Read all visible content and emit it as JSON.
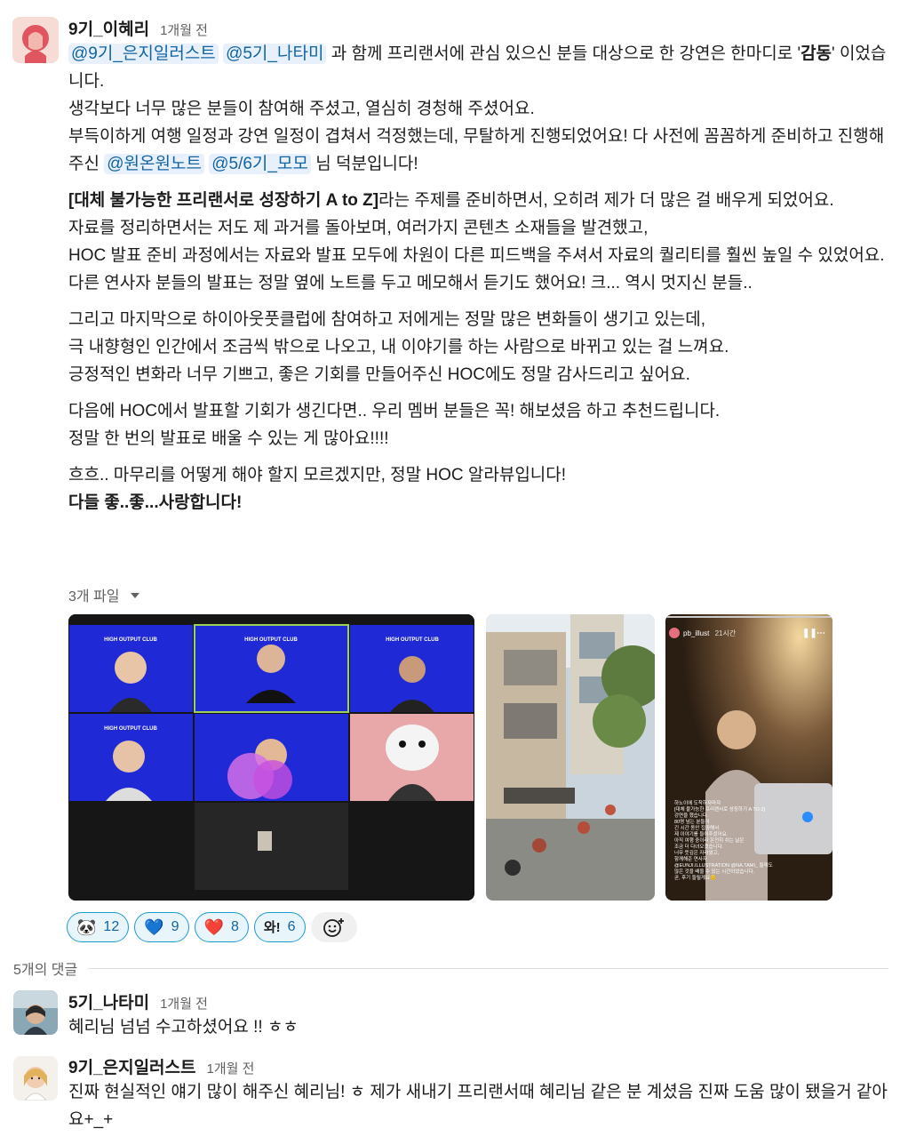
{
  "post": {
    "author": "9기_이혜리",
    "time": "1개월 전",
    "mentions": {
      "m1": "@9기_은지일러스트",
      "m2": "@5기_나타미",
      "m3": "@원온원노트",
      "m4": "@5/6기_모모"
    },
    "p1_after_mentions": " 과 함께 프리랜서에 관심 있으신 분들 대상으로 한 강연은 한마디로 '",
    "p1_bold": "감동",
    "p1_end": "' 이었습니다.",
    "p2": "생각보다 너무 많은 분들이 참여해 주셨고, 열심히 경청해 주셨어요.",
    "p3a": "부득이하게 여행 일정과 강연 일정이 겹쳐서 걱정했는데, 무탈하게 진행되었어요! 다 사전에 꼼꼼하게 준비하고 진행해주신 ",
    "p3b": " 님 덕분입니다!",
    "p4_bold": "[대체 불가능한 프리랜서로 성장하기 A to Z]",
    "p4": "라는 주제를 준비하면서, 오히려 제가 더 많은 걸 배우게 되었어요.",
    "p5": "자료를 정리하면서는 저도 제 과거를 돌아보며, 여러가지 콘텐츠 소재들을 발견했고,",
    "p6": "HOC 발표 준비 과정에서는 자료와 발표 모두에 차원이 다른 피드백을 주셔서 자료의 퀄리티를 훨씬 높일 수 있었어요.",
    "p7": "다른 연사자 분들의 발표는 정말 옆에 노트를 두고 메모해서 듣기도 했어요! 크... 역시 멋지신 분들..",
    "p8": "그리고 마지막으로 하이아웃풋클럽에 참여하고 저에게는 정말 많은 변화들이 생기고 있는데,",
    "p9": "극 내향형인 인간에서 조금씩 밖으로 나오고, 내 이야기를 하는 사람으로 바뀌고 있는 걸 느껴요.",
    "p10": "긍정적인 변화라 너무 기쁘고, 좋은 기회를 만들어주신 HOC에도 정말 감사드리고 싶어요.",
    "p11": "다음에 HOC에서 발표할 기회가 생긴다면.. 우리 멤버 분들은 꼭! 해보셨음 하고 추천드립니다.",
    "p12": "정말 한 번의 발표로 배울 수 있는 게 많아요!!!!",
    "p13": "흐흐.. 마무리를 어떻게 해야 할지 모르겠지만, 정말 HOC 알라뷰입니다!",
    "p14_bold": "다들 좋..좋...사랑합니다!"
  },
  "files": {
    "label": "3개 파일",
    "zoom_tile_label": "HIGH OUTPUT CLUB",
    "story_user": "pb_illust",
    "story_time": "21시간",
    "story_caption": [
      "하노이에 도착하자마자",
      "[대체 불가능한 프리랜서로 성장하기 A TO Z]",
      "강연을 했습니다.",
      "80명 넘는 분들이",
      "긴 시간 동안 집중해서",
      "제 이야기를 들어주셨어요.",
      "아직 여행 중이라 온전히 쉬는 날은",
      "조금 더 다녀오겠습니다.",
      "너무 뜻깊은 자리였고,",
      "함께해준 연사자",
      "@EUNJI.ILLUSTRATION @NA.TAMI_ 들께도",
      "많은 것을 배울 수 있는 시간이었습니다.",
      "곧, 후기 들릴게요😊"
    ]
  },
  "reactions": [
    {
      "emoji": "🐼",
      "count": "12"
    },
    {
      "emoji": "💙",
      "count": "9"
    },
    {
      "emoji": "❤️",
      "count": "8"
    },
    {
      "emoji": "와!",
      "count": "6"
    }
  ],
  "replies_label": "5개의 댓글",
  "comments": [
    {
      "author": "5기_나타미",
      "time": "1개월 전",
      "text": "혜리님 넘넘 수고하셨어요 !! ㅎㅎ"
    },
    {
      "author": "9기_은지일러스트",
      "time": "1개월 전",
      "text": "진짜 현실적인 얘기 많이 해주신 혜리님! ㅎ 제가 새내기 프리랜서때 혜리님 같은 분 계셨음 진짜 도움 많이 됐을거 같아요+_+"
    }
  ]
}
